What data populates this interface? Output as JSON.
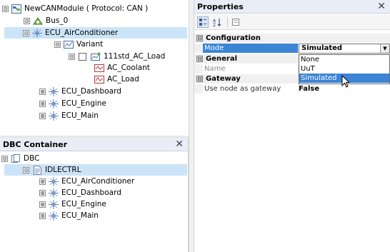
{
  "network_tree": {
    "root": {
      "label": "NewCANModule ( Protocol: CAN )",
      "expander": "⊟"
    },
    "bus": {
      "label": "Bus_0",
      "expander": "⊟"
    },
    "node_selected": {
      "label": "ECU_AirConditioner",
      "expander": "⊟"
    },
    "variant": {
      "label": "Variant",
      "expander": "⊟"
    },
    "load_node": {
      "label": "111std_AC_Load",
      "expander": "⊟"
    },
    "signals": [
      {
        "label": "AC_Coolant"
      },
      {
        "label": "AC_Load"
      }
    ],
    "other_nodes": [
      {
        "label": "ECU_Dashboard",
        "expander": "⊞"
      },
      {
        "label": "ECU_Engine",
        "expander": "⊞"
      },
      {
        "label": "ECU_Main",
        "expander": "⊞"
      }
    ]
  },
  "dbc_container": {
    "title": "DBC Container",
    "close_glyph": "✕",
    "root": {
      "label": "DBC",
      "expander": "⊟"
    },
    "file": {
      "label": "IDLECTRL",
      "expander": "⊟"
    },
    "nodes": [
      {
        "label": "ECU_AirConditioner",
        "expander": "⊞"
      },
      {
        "label": "ECU_Dashboard",
        "expander": "⊞"
      },
      {
        "label": "ECU_Engine",
        "expander": "⊞"
      },
      {
        "label": "ECU_Main",
        "expander": "⊞"
      }
    ]
  },
  "properties": {
    "title": "Properties",
    "close_glyph": "✕",
    "toolbar": {
      "categorized_icon": "categorized-icon",
      "alpha_icon": "alphabetical-sort-icon",
      "pages_icon": "property-pages-icon"
    },
    "categories": {
      "configuration": {
        "label": "Configuration",
        "expander": "⊟"
      },
      "general": {
        "label": "General",
        "expander": "⊟"
      },
      "gateway": {
        "label": "Gateway",
        "expander": "⊟"
      }
    },
    "rows": {
      "mode": {
        "name": "Mode",
        "value": "Simulated"
      },
      "name": {
        "name": "Name",
        "value": ""
      },
      "use_gateway": {
        "name": "Use node as gateway",
        "value": "False"
      }
    },
    "dropdown_options": [
      "None",
      "UuT",
      "Simulated"
    ],
    "dropdown_selected": "Simulated",
    "combo_arrow": "▼"
  },
  "colors": {
    "selection": "#cce4f7",
    "highlight": "#3b84d6",
    "header_bg": "#e9eef6"
  }
}
